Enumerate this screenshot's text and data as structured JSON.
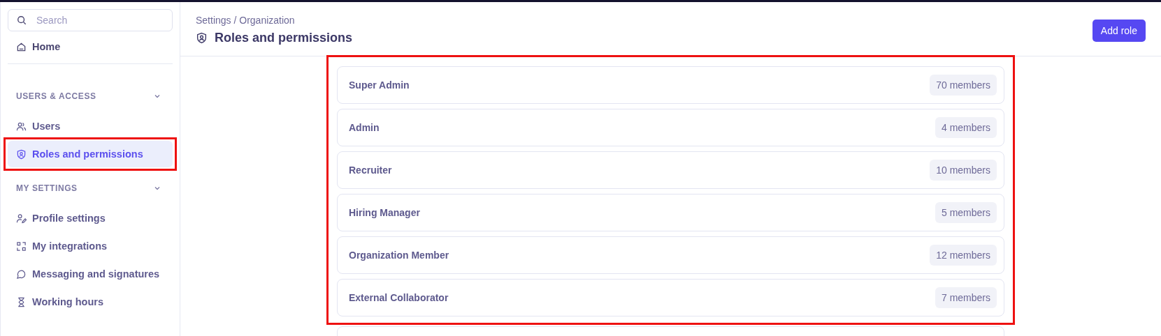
{
  "sidebar": {
    "search": {
      "placeholder": "Search"
    },
    "home": {
      "label": "Home",
      "kind": "home"
    },
    "sections": [
      {
        "title": "USERS & ACCESS",
        "expanded": true,
        "items": [
          {
            "label": "Users",
            "kind": "users",
            "selected": false,
            "highlighted": false
          },
          {
            "label": "Roles and permissions",
            "kind": "shield",
            "selected": true,
            "highlighted": true
          }
        ]
      },
      {
        "title": "MY SETTINGS",
        "expanded": true,
        "items": [
          {
            "label": "Profile settings",
            "kind": "profile",
            "selected": false,
            "highlighted": false
          },
          {
            "label": "My integrations",
            "kind": "integrations",
            "selected": false,
            "highlighted": false
          },
          {
            "label": "Messaging and signatures",
            "kind": "chat",
            "selected": false,
            "highlighted": false
          },
          {
            "label": "Working hours",
            "kind": "hourglass",
            "selected": false,
            "highlighted": false
          }
        ]
      }
    ]
  },
  "header": {
    "breadcrumb": "Settings / Organization",
    "title": "Roles and permissions",
    "button": "Add role"
  },
  "roles_highlighted": true,
  "roles": [
    {
      "name": "Super Admin",
      "members": "70 members"
    },
    {
      "name": "Admin",
      "members": "4 members"
    },
    {
      "name": "Recruiter",
      "members": "10 members"
    },
    {
      "name": "Hiring Manager",
      "members": "5 members"
    },
    {
      "name": "Organization Member",
      "members": "12 members"
    },
    {
      "name": "External Collaborator",
      "members": "7 members"
    }
  ]
}
